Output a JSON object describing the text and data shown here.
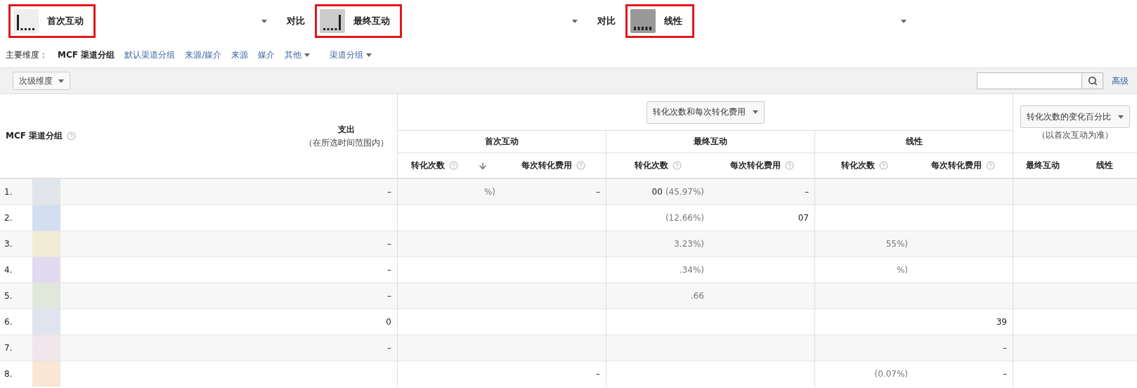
{
  "models": [
    {
      "kind": "first",
      "label": "首次互动",
      "highlighted": true
    },
    {
      "kind": "last",
      "label": "最终互动",
      "highlighted": true
    },
    {
      "kind": "linear",
      "label": "线性",
      "highlighted": true
    }
  ],
  "compare_labels": [
    "对比",
    "对比"
  ],
  "dimensions": {
    "label": "主要维度：",
    "items": [
      {
        "label": "MCF 渠道分组",
        "selected": true,
        "kind": "link"
      },
      {
        "label": "默认渠道分组",
        "selected": false,
        "kind": "link"
      },
      {
        "label": "来源/媒介",
        "selected": false,
        "kind": "link"
      },
      {
        "label": "来源",
        "selected": false,
        "kind": "link"
      },
      {
        "label": "媒介",
        "selected": false,
        "kind": "link"
      },
      {
        "label": "其他",
        "selected": false,
        "kind": "menu"
      },
      {
        "label": "渠道分组",
        "selected": false,
        "kind": "menu"
      }
    ]
  },
  "toolbar": {
    "secondary_dimension": "次级维度",
    "advanced_link": "高级"
  },
  "table": {
    "channel_header": "MCF 渠道分组",
    "spend_header": "支出",
    "spend_note": "（在所选时间范围内）",
    "metric_select": "转化次数和每次转化费用",
    "groups": [
      {
        "title": "首次互动",
        "columns": [
          {
            "label": "转化次数",
            "sorted": true
          },
          {
            "label": "每次转化费用",
            "sorted": false
          }
        ]
      },
      {
        "title": "最终互动",
        "columns": [
          {
            "label": "转化次数",
            "sorted": false
          },
          {
            "label": "每次转化费用",
            "sorted": false
          }
        ]
      },
      {
        "title": "线性",
        "columns": [
          {
            "label": "转化次数",
            "sorted": false
          },
          {
            "label": "每次转化费用",
            "sorted": false
          }
        ]
      }
    ],
    "change_select": "转化次数的变化百分比",
    "change_note": "（以首次互动为准）",
    "change_columns": [
      "最终互动",
      "线性"
    ],
    "rows": [
      {
        "index": "1.",
        "color": "#e1e6ea",
        "cells": [
          "–",
          {
            "share": "%)"
          },
          "–",
          {
            "value": "00",
            "share": "(45.97%)"
          },
          "–",
          "",
          "",
          "",
          ""
        ]
      },
      {
        "index": "2.",
        "color": "#d3dff1",
        "cells": [
          "",
          "",
          "",
          {
            "share": "(12.66%)"
          },
          "07",
          "",
          "",
          "",
          ""
        ]
      },
      {
        "index": "3.",
        "color": "#f1ecd6",
        "cells": [
          "–",
          "",
          "",
          {
            "share": "3.23%)"
          },
          "",
          {
            "share": "55%)"
          },
          "",
          "",
          ""
        ]
      },
      {
        "index": "4.",
        "color": "#e2daf0",
        "cells": [
          "–",
          "",
          "",
          {
            "share": ".34%)"
          },
          "",
          {
            "share": "%)"
          },
          "",
          "",
          ""
        ]
      },
      {
        "index": "5.",
        "color": "#e0e8dc",
        "cells": [
          "–",
          "",
          "",
          {
            "share": ".66"
          },
          "",
          "",
          "",
          "",
          ""
        ]
      },
      {
        "index": "6.",
        "color": "#dfe4ee",
        "cells": [
          "0",
          "",
          "",
          "",
          "",
          "",
          "39",
          "",
          ""
        ]
      },
      {
        "index": "7.",
        "color": "#f1e6ec",
        "cells": [
          "–",
          "",
          "",
          "",
          "",
          "",
          "–",
          "",
          ""
        ]
      },
      {
        "index": "8.",
        "color": "#f9e6d4",
        "cells": [
          "",
          "",
          "–",
          "",
          "",
          {
            "share": "(0.07%)"
          },
          "–",
          "",
          ""
        ]
      }
    ]
  }
}
